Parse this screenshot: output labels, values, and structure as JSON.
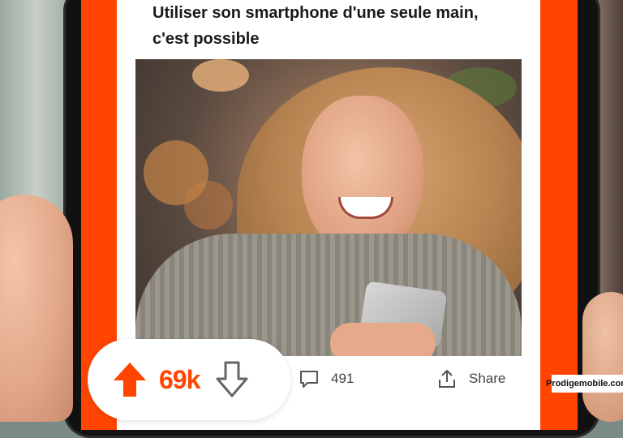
{
  "post": {
    "title": "Utiliser son smartphone d'une seule main, c'est possible",
    "image_alt": "photo"
  },
  "votes": {
    "count": "69k",
    "upvote_icon": "arrow-up-icon",
    "downvote_icon": "arrow-down-icon"
  },
  "comments": {
    "count": "491",
    "icon": "comment-icon"
  },
  "share": {
    "label": "Share",
    "icon": "share-icon"
  },
  "watermark": "Prodigemobile.com",
  "colors": {
    "accent": "#ff4500",
    "card": "#ffffff",
    "text": "#1a1a1b"
  }
}
